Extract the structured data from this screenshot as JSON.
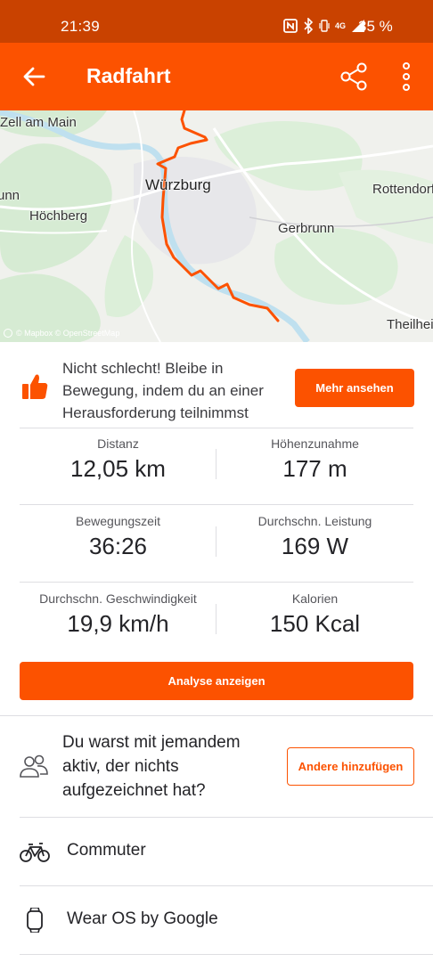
{
  "status_bar": {
    "time": "21:39",
    "network": "4G",
    "battery": "35 %"
  },
  "app_bar": {
    "title": "Radfahrt"
  },
  "map": {
    "labels": {
      "zell": "Zell am Main",
      "wurzburg": "Würzburg",
      "rottendorf": "Rottendorf",
      "unn": "unn",
      "hochberg": "Höchberg",
      "gerbrunn": "Gerbrunn",
      "theilheim": "Theilhei"
    },
    "attribution": "© Mapbox © OpenStreetMap",
    "route_color": "#fc5200"
  },
  "promo": {
    "text": "Nicht schlecht! Bleibe in Bewegung, indem du an einer Herausforderung teilnimmst",
    "button": "Mehr ansehen"
  },
  "stats": [
    {
      "left": {
        "label": "Distanz",
        "value": "12,05 km"
      },
      "right": {
        "label": "Höhenzunahme",
        "value": "177 m"
      }
    },
    {
      "left": {
        "label": "Bewegungszeit",
        "value": "36:26"
      },
      "right": {
        "label": "Durchschn. Leistung",
        "value": "169 W"
      }
    },
    {
      "left": {
        "label": "Durchschn. Geschwindigkeit",
        "value": "19,9 km/h"
      },
      "right": {
        "label": "Kalorien",
        "value": "150 Kcal"
      }
    }
  ],
  "analysis_button": "Analyse anzeigen",
  "together": {
    "text": "Du warst mit jemandem aktiv, der nichts aufgezeichnet hat?",
    "button": "Andere hinzufügen"
  },
  "gear": {
    "bike": "Commuter",
    "device": "Wear OS by Google"
  },
  "colors": {
    "brand": "#fc5200",
    "status_bar": "#c94200"
  }
}
